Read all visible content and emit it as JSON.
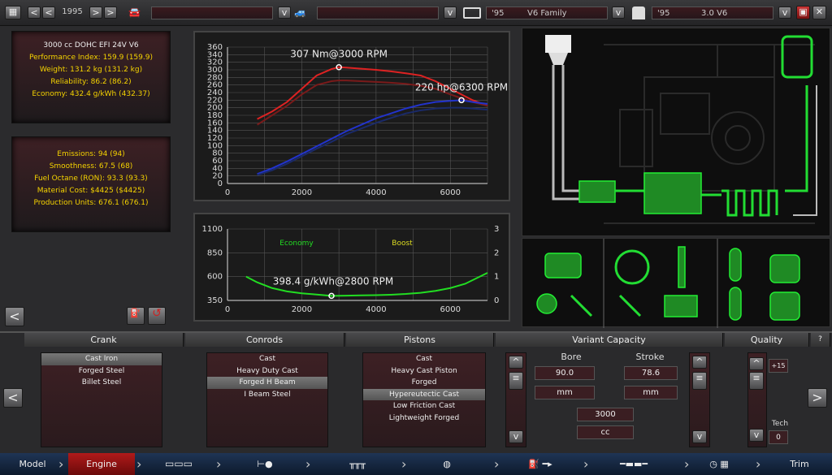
{
  "top": {
    "year": "1995",
    "model_value": "",
    "trim_value": "",
    "family_year": "'95",
    "family_name": "V6 Family",
    "variant_year": "'95",
    "variant_name": "3.0 V6"
  },
  "stats1": {
    "title": "3000 cc DOHC EFI 24V V6",
    "items": [
      "Performance Index: 159.9 (159.9)",
      "Weight: 131.2 kg (131.2 kg)",
      "Reliability: 86.2 (86.2)",
      "Economy: 432.4 g/kWh (432.37)"
    ]
  },
  "stats2": {
    "items": [
      "Emissions: 94 (94)",
      "Smoothness: 67.5 (68)",
      "Fuel Octane (RON): 93.3 (93.3)",
      "Material Cost: $4425 ($4425)",
      "Production Units: 676.1 (676.1)"
    ]
  },
  "chart_data": [
    {
      "type": "line",
      "x": [
        800,
        1200,
        1600,
        2000,
        2400,
        2800,
        3000,
        3200,
        3600,
        4000,
        4400,
        4800,
        5200,
        5600,
        6000,
        6300,
        6600,
        7000
      ],
      "series": [
        {
          "values": [
            170,
            190,
            215,
            250,
            285,
            302,
            307,
            306,
            303,
            300,
            296,
            291,
            285,
            270,
            250,
            235,
            220,
            205
          ],
          "color": "#dd2222"
        },
        {
          "values": [
            155,
            180,
            205,
            235,
            260,
            270,
            272,
            272,
            270,
            268,
            266,
            263,
            258,
            250,
            235,
            225,
            215,
            205
          ],
          "color": "#7a1a1a"
        },
        {
          "values": [
            25,
            40,
            58,
            78,
            98,
            118,
            128,
            138,
            155,
            172,
            185,
            198,
            208,
            215,
            218,
            220,
            215,
            210
          ],
          "color": "#2233cc"
        },
        {
          "values": [
            22,
            35,
            52,
            72,
            92,
            110,
            120,
            130,
            145,
            160,
            173,
            185,
            193,
            198,
            200,
            200,
            198,
            195
          ],
          "color": "#1a2a6a"
        }
      ],
      "ylim": [
        0,
        360
      ],
      "xlim": [
        0,
        7000
      ],
      "yticks": [
        0,
        20,
        40,
        60,
        80,
        100,
        120,
        140,
        160,
        180,
        200,
        220,
        240,
        260,
        280,
        300,
        320,
        340,
        360
      ],
      "xticks": [
        0,
        2000,
        4000,
        6000
      ],
      "annotations": [
        "307 Nm@3000 RPM",
        "220 hp@6300 RPM"
      ]
    },
    {
      "type": "line",
      "x": [
        500,
        800,
        1200,
        1600,
        2000,
        2400,
        2800,
        3200,
        3600,
        4000,
        4400,
        4800,
        5200,
        5600,
        6000,
        6400,
        7000
      ],
      "series": [
        {
          "name": "Economy",
          "values": [
            600,
            540,
            480,
            445,
            425,
            412,
            398,
            400,
            403,
            405,
            410,
            418,
            430,
            450,
            480,
            525,
            640
          ],
          "color": "#22dd22"
        }
      ],
      "ylim": [
        350,
        1100
      ],
      "yticks": [
        350,
        600,
        850,
        1100
      ],
      "y2ticks": [
        0,
        1,
        2,
        3
      ],
      "xticks": [
        0,
        2000,
        4000,
        6000
      ],
      "legend": [
        "Economy",
        "Boost"
      ],
      "annotations": [
        "398.4 g/kWh@2800 RPM"
      ]
    }
  ],
  "columns": {
    "crank": "Crank",
    "conrods": "Conrods",
    "pistons": "Pistons",
    "variant": "Variant Capacity",
    "quality": "Quality",
    "help": "?"
  },
  "crank": [
    "Cast Iron",
    "Forged Steel",
    "Billet Steel"
  ],
  "conrods": [
    "Cast",
    "Heavy Duty Cast",
    "Forged H Beam",
    "I Beam Steel"
  ],
  "pistons": [
    "Cast",
    "Heavy Cast Piston",
    "Forged",
    "Hypereutectic Cast",
    "Low Friction Cast",
    "Lightweight Forged"
  ],
  "variant": {
    "bore_label": "Bore",
    "stroke_label": "Stroke",
    "bore": "90.0",
    "stroke": "78.6",
    "unit": "mm",
    "unit2": "mm",
    "capacity": "3000",
    "cc": "cc"
  },
  "quality": {
    "value": "+15",
    "tech_label": "Tech",
    "tech": "0"
  },
  "nav": {
    "model": "Model",
    "engine": "Engine",
    "trim": "Trim"
  }
}
